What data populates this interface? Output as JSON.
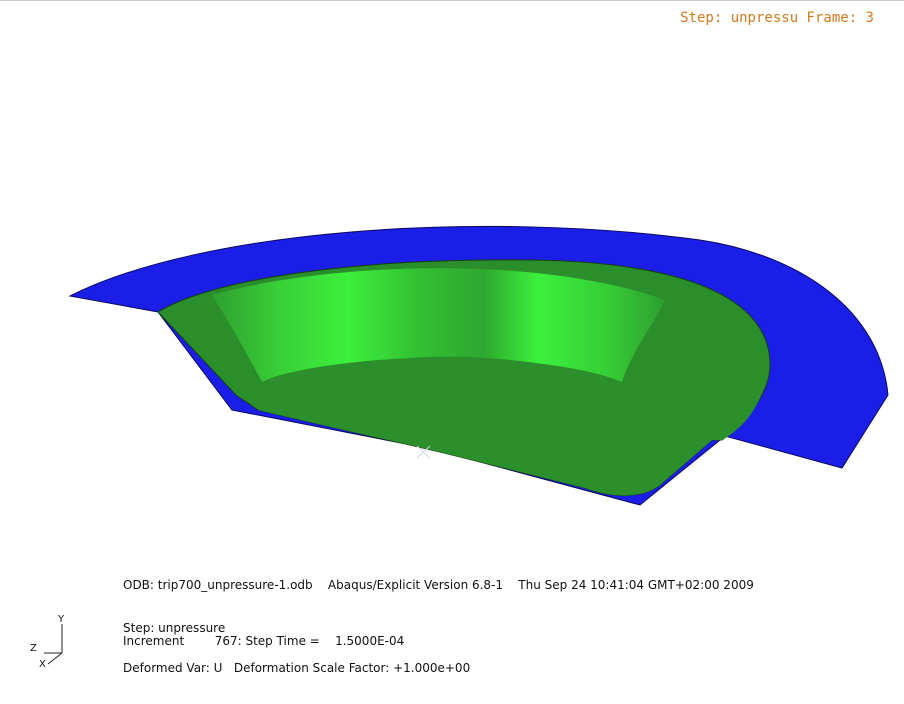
{
  "viewport": {
    "frame_label": "Step: unpressu Frame: 3",
    "colors": {
      "outer_surface": "#1a1ee6",
      "inner_surface": "#2a8f2a",
      "highlight": "#3df53d",
      "frame_text": "#d07a1e"
    }
  },
  "info": {
    "odb_line": "ODB: trip700_unpressure-1.odb    Abaqus/Explicit Version 6.8-1    Thu Sep 24 10:41:04 GMT+02:00 2009",
    "step_line": "Step: unpressure",
    "increment_line": "Increment        767: Step Time =    1.5000E-04",
    "deformed_line": "Deformed Var: U   Deformation Scale Factor: +1.000e+00"
  },
  "triad": {
    "y_label": "Y",
    "z_label": "Z",
    "x_label": "X"
  }
}
